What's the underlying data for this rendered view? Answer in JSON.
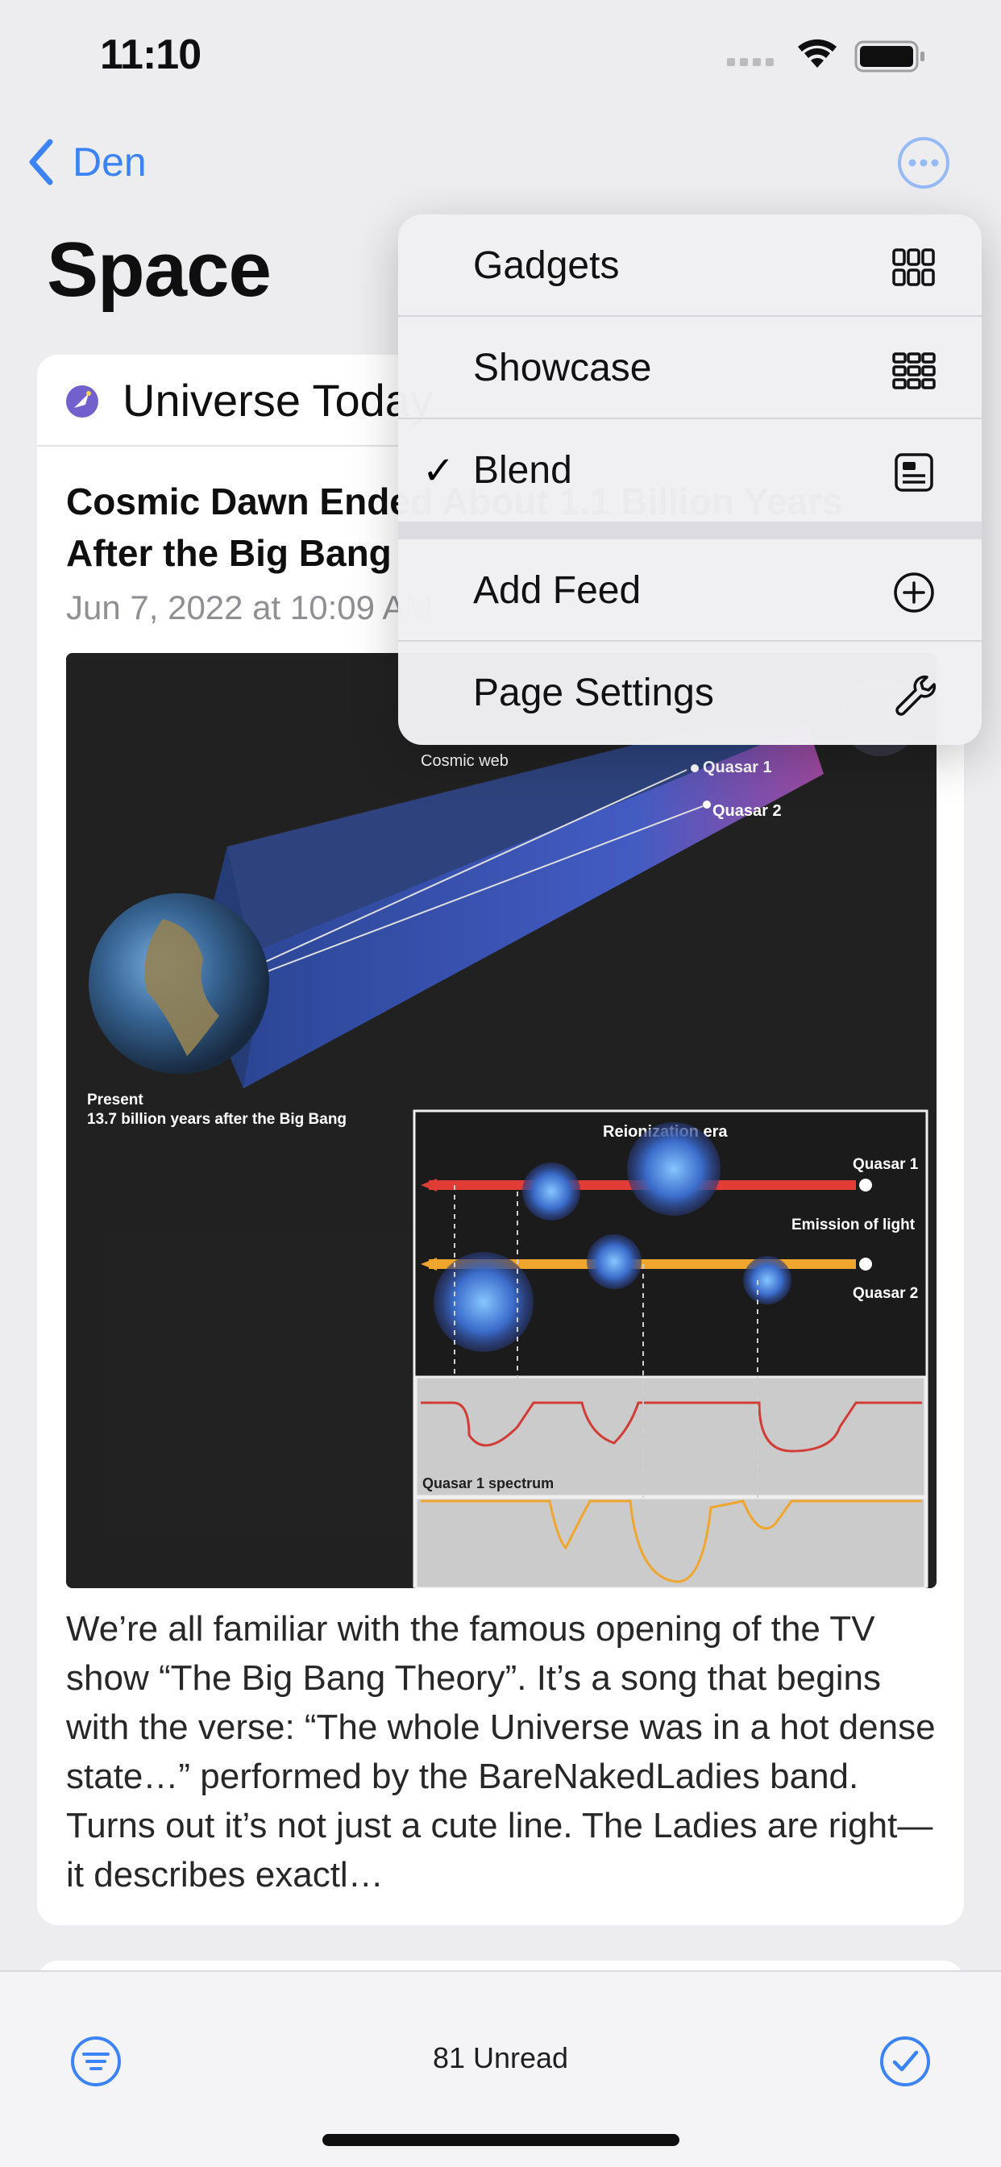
{
  "status_bar": {
    "time": "11:10"
  },
  "nav": {
    "back_label": "Den"
  },
  "page": {
    "title": "Space"
  },
  "card": {
    "feed_name": "Universe Today",
    "article_title": "Cosmic Dawn Ended About 1.1 Billion Years After the Big Bang",
    "article_date": "Jun 7, 2022 at 10:09 AM",
    "article_body": "We’re all familiar with the famous opening of the TV show “The Big Bang Theory”. It’s a song that begins with the verse: “The whole Universe was in a hot dense state…” performed by the BareNakedLadies band. Turns out it’s not just a cute line. The Ladies are right—it describes exactl…",
    "image_labels": {
      "cosmic_web": "Cosmic web",
      "quasar1": "Quasar 1",
      "quasar2": "Quasar 2",
      "present": "Present",
      "present_sub": "13.7 billion years after the Big Bang",
      "reionization": "Reionization era",
      "emission": "Emission of light",
      "spectrum1": "Quasar 1 spectrum"
    }
  },
  "menu": {
    "items": [
      {
        "label": "Gadgets",
        "icon": "grid-3x2-icon",
        "checked": false
      },
      {
        "label": "Showcase",
        "icon": "grid-4x2-icon",
        "checked": false
      },
      {
        "label": "Blend",
        "icon": "article-icon",
        "checked": true
      },
      {
        "label": "Add Feed",
        "icon": "plus-circle-icon",
        "checked": false
      },
      {
        "label": "Page Settings",
        "icon": "wrench-icon",
        "checked": false
      }
    ],
    "check_glyph": "✓"
  },
  "toolbar": {
    "unread_label": "81 Unread"
  },
  "colors": {
    "accent": "#2f7cf6",
    "background": "#ececef"
  }
}
